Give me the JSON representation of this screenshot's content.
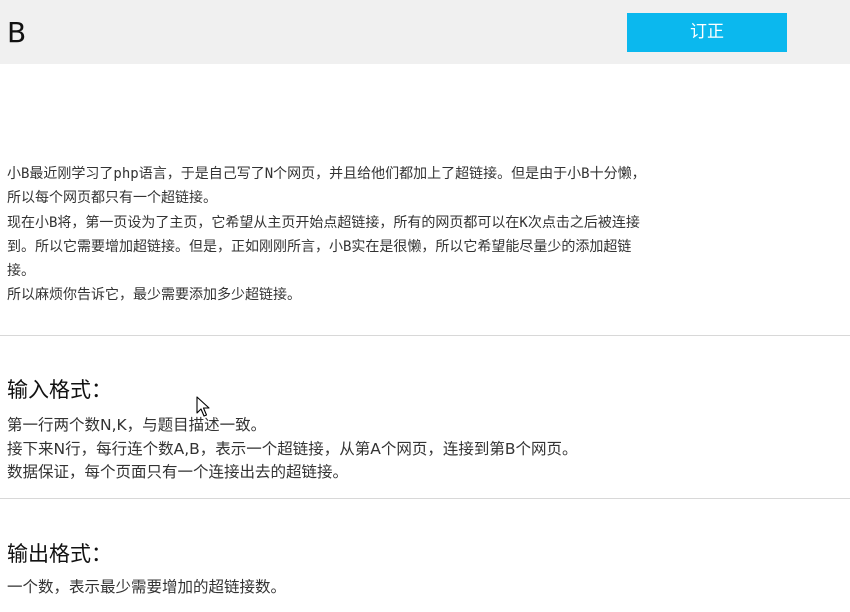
{
  "header": {
    "title": "B",
    "correct_button_label": "订正"
  },
  "description": {
    "lines": [
      "小B最近刚学习了php语言，于是自己写了N个网页，并且给他们都加上了超链接。但是由于小B十分懒，",
      "所以每个网页都只有一个超链接。",
      "现在小B将，第一页设为了主页，它希望从主页开始点超链接，所有的网页都可以在K次点击之后被连接",
      "到。所以它需要增加超链接。但是，正如刚刚所言，小B实在是很懒，所以它希望能尽量少的添加超链",
      "接。",
      "所以麻烦你告诉它，最少需要添加多少超链接。"
    ]
  },
  "input_section": {
    "title": "输入格式：",
    "lines": [
      "第一行两个数N,K，与题目描述一致。",
      "接下来N行，每行连个数A,B，表示一个超链接，从第A个网页，连接到第B个网页。",
      "数据保证，每个页面只有一个连接出去的超链接。"
    ]
  },
  "output_section": {
    "title": "输出格式：",
    "lines": [
      "一个数，表示最少需要增加的超链接数。"
    ]
  },
  "colors": {
    "header_bg": "#f0f0f0",
    "button_bg": "#0bb8ee",
    "button_text": "#ffffff",
    "divider": "#d8d8d8"
  },
  "icons": {
    "cursor": "mouse-pointer-icon"
  }
}
